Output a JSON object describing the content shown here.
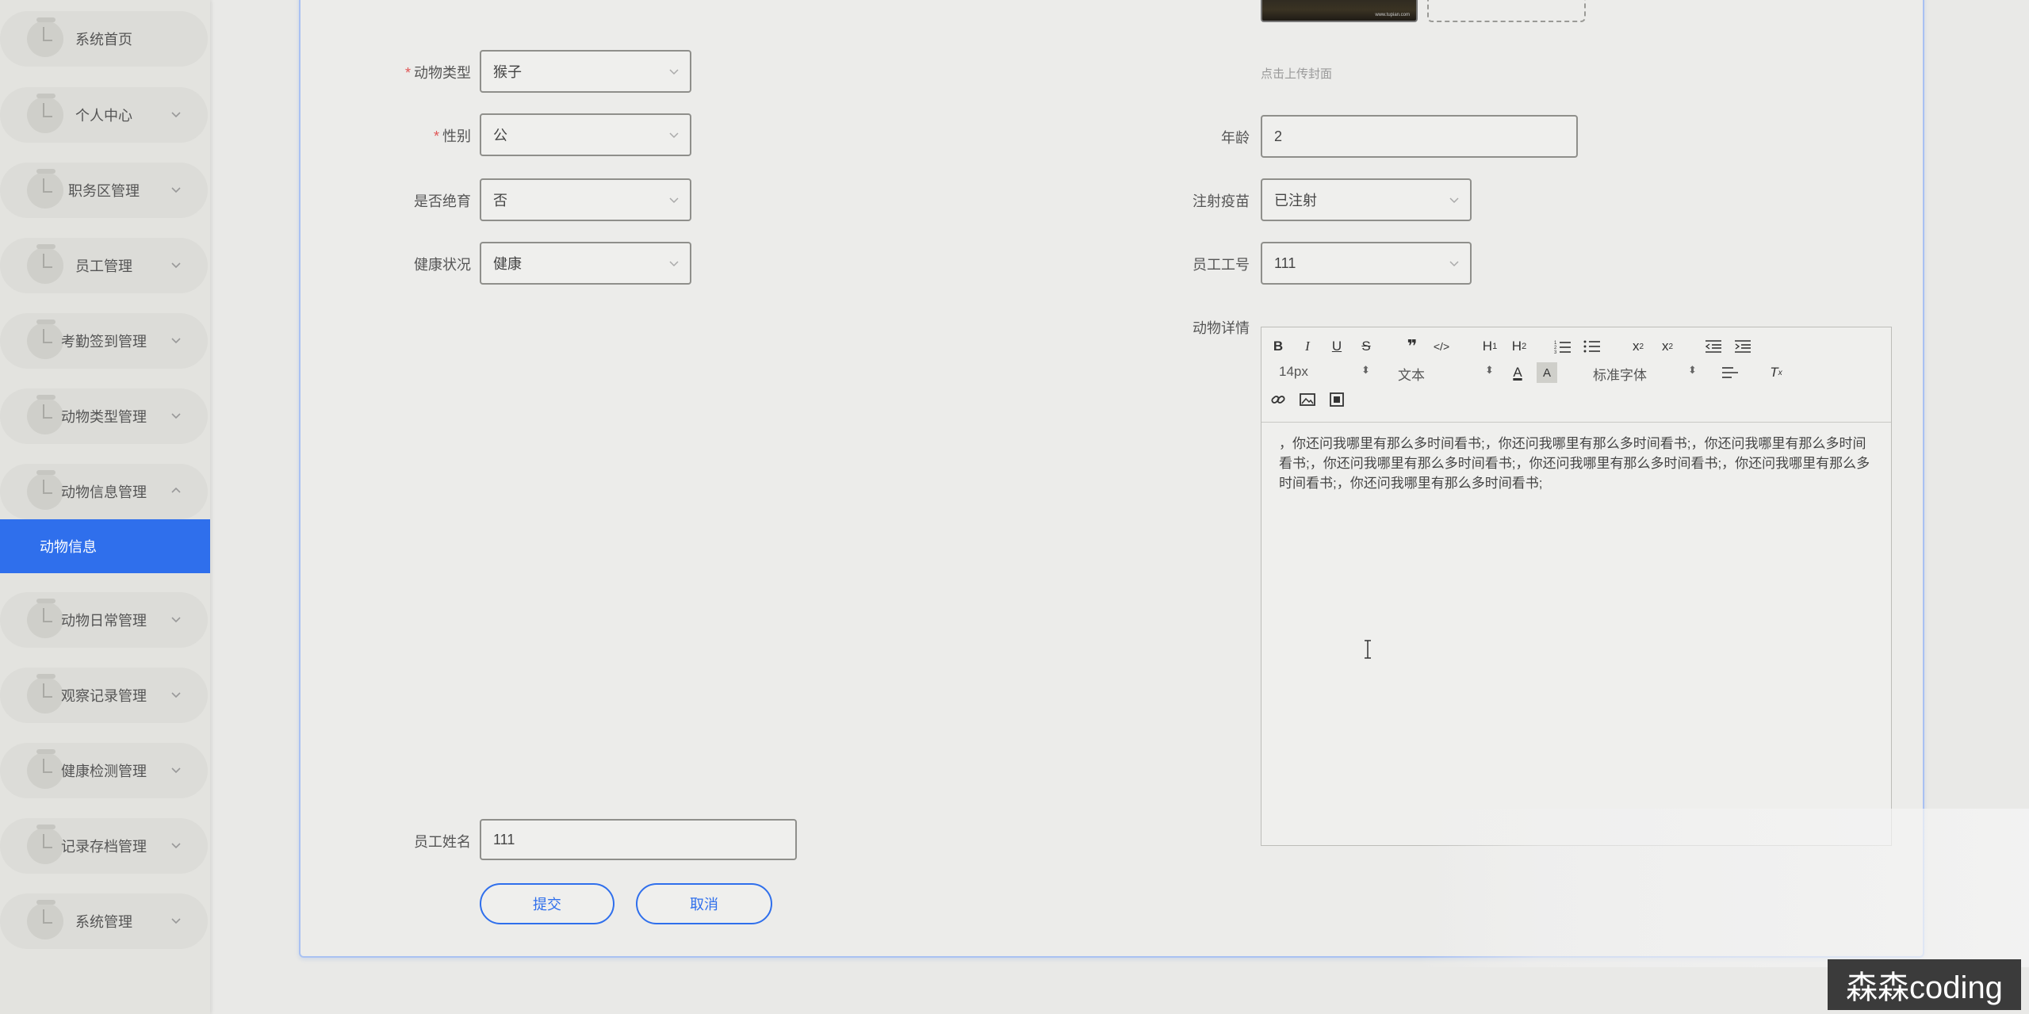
{
  "sidebar": {
    "items": [
      {
        "label": "系统首页"
      },
      {
        "label": "个人中心"
      },
      {
        "label": "职务区管理"
      },
      {
        "label": "员工管理"
      },
      {
        "label": "考勤签到管理"
      },
      {
        "label": "动物类型管理"
      },
      {
        "label": "动物信息管理"
      },
      {
        "label": "动物日常管理"
      },
      {
        "label": "观察记录管理"
      },
      {
        "label": "健康检测管理"
      },
      {
        "label": "记录存档管理"
      },
      {
        "label": "系统管理"
      }
    ],
    "active_sub_item": "动物信息"
  },
  "form": {
    "animal_type": {
      "label": "动物类型",
      "value": "猴子",
      "required": "*"
    },
    "gender": {
      "label": "性别",
      "value": "公",
      "required": "*"
    },
    "sterilized": {
      "label": "是否绝育",
      "value": "否"
    },
    "health": {
      "label": "健康状况",
      "value": "健康"
    },
    "cover_hint": "点击上传封面",
    "cover_thumb_caption": "www.tupian.com",
    "age": {
      "label": "年龄",
      "value": "2"
    },
    "vaccinated": {
      "label": "注射疫苗",
      "value": "已注射"
    },
    "employee_id": {
      "label": "员工工号",
      "value": "111"
    },
    "details": {
      "label": "动物详情"
    },
    "employee_name": {
      "label": "员工姓名",
      "value": "111"
    }
  },
  "editor": {
    "font_size": "14px",
    "text_type": "文本",
    "font_family": "标准字体",
    "content": "，你还问我哪里有那么多时间看书;，你还问我哪里有那么多时间看书;，你还问我哪里有那么多时间看书;，你还问我哪里有那么多时间看书;，你还问我哪里有那么多时间看书;，你还问我哪里有那么多时间看书;，你还问我哪里有那么多时间看书;"
  },
  "buttons": {
    "submit": "提交",
    "cancel": "取消"
  },
  "watermark": "森森coding",
  "colors": {
    "accent": "#2f6fec",
    "required": "#e05555"
  }
}
